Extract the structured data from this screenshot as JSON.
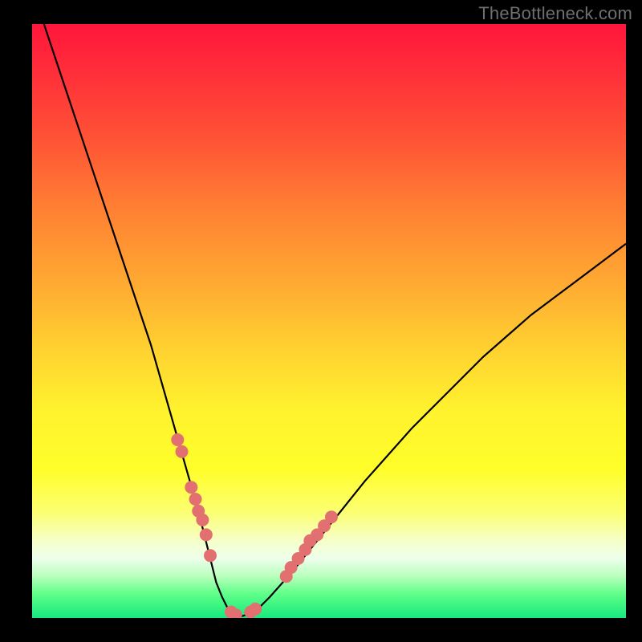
{
  "watermark": "TheBottleneck.com",
  "colors": {
    "frame": "#000000",
    "curve": "#000000",
    "marker": "#e37070",
    "gradient_top": "#ff163b",
    "gradient_bottom": "#17e97e"
  },
  "chart_data": {
    "type": "line",
    "title": "",
    "xlabel": "",
    "ylabel": "",
    "xlim": [
      0,
      100
    ],
    "ylim": [
      0,
      100
    ],
    "curve": {
      "x": [
        2,
        5,
        8,
        11,
        14,
        17,
        20,
        22,
        24,
        26,
        28,
        29,
        30,
        31,
        32,
        33,
        34,
        35,
        36,
        38,
        40,
        44,
        48,
        52,
        56,
        60,
        64,
        68,
        72,
        76,
        80,
        84,
        88,
        92,
        96,
        100
      ],
      "y": [
        100,
        91,
        82,
        73,
        64,
        55,
        46,
        39,
        32,
        25,
        18,
        14,
        10,
        6,
        3.5,
        1.5,
        0.5,
        0.2,
        0.5,
        1.5,
        3.5,
        8,
        13,
        18,
        23,
        27.5,
        32,
        36,
        40,
        44,
        47.5,
        51,
        54,
        57,
        60,
        63
      ]
    },
    "series": [
      {
        "name": "markers",
        "x": [
          24.5,
          25.2,
          26.8,
          27.5,
          28.0,
          28.7,
          29.3,
          30.0,
          33.5,
          34.3,
          36.8,
          37.6,
          42.8,
          43.6,
          44.8,
          46.0,
          46.8,
          48.0,
          49.2,
          50.4
        ],
        "y": [
          30.0,
          28.0,
          22.0,
          20.0,
          18.0,
          16.5,
          14.0,
          10.5,
          1.0,
          0.5,
          1.0,
          1.5,
          7.0,
          8.5,
          10.0,
          11.5,
          13.0,
          14.0,
          15.5,
          17.0
        ]
      }
    ],
    "marker_radius_px": 8
  }
}
